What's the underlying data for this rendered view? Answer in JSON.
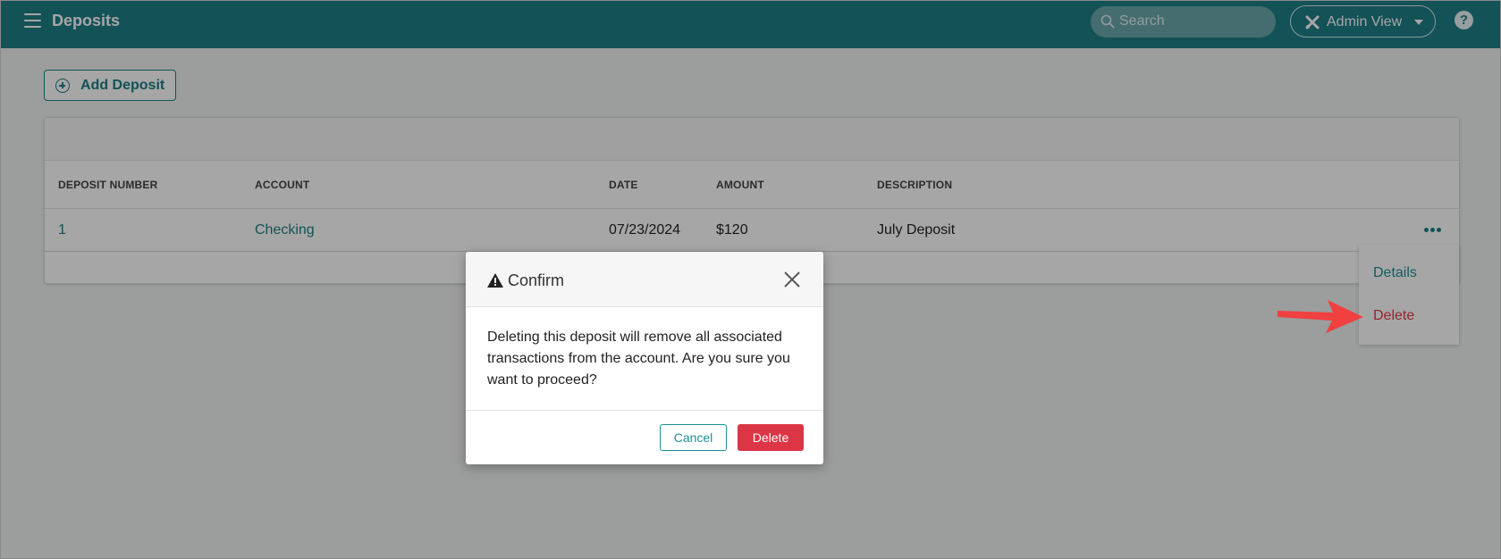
{
  "header": {
    "title": "Deposits",
    "search_placeholder": "Search",
    "admin_view_label": "Admin View",
    "help_label": "?"
  },
  "toolbar": {
    "add_deposit_label": "Add Deposit"
  },
  "table": {
    "columns": [
      "DEPOSIT NUMBER",
      "ACCOUNT",
      "DATE",
      "AMOUNT",
      "DESCRIPTION"
    ],
    "rows": [
      {
        "number": "1",
        "account": "Checking",
        "date": "07/23/2024",
        "amount": "$120",
        "description": "July Deposit"
      }
    ]
  },
  "row_menu": {
    "items": [
      "Details",
      "Delete"
    ]
  },
  "modal": {
    "title": "Confirm",
    "message": "Deleting this deposit will remove all associated transactions from the account. Are you sure you want to proceed?",
    "cancel_label": "Cancel",
    "delete_label": "Delete"
  },
  "colors": {
    "header_bg": "#1e7e86",
    "danger": "#dc3545",
    "link": "#1e7e86",
    "annotation_arrow": "#f04040"
  },
  "icons": [
    "menu-icon",
    "search-icon",
    "tools-icon",
    "chevron-down-icon",
    "help-icon",
    "plus-circle-icon",
    "more-horizontal-icon",
    "warning-icon",
    "close-icon",
    "arrow-annotation-icon"
  ]
}
